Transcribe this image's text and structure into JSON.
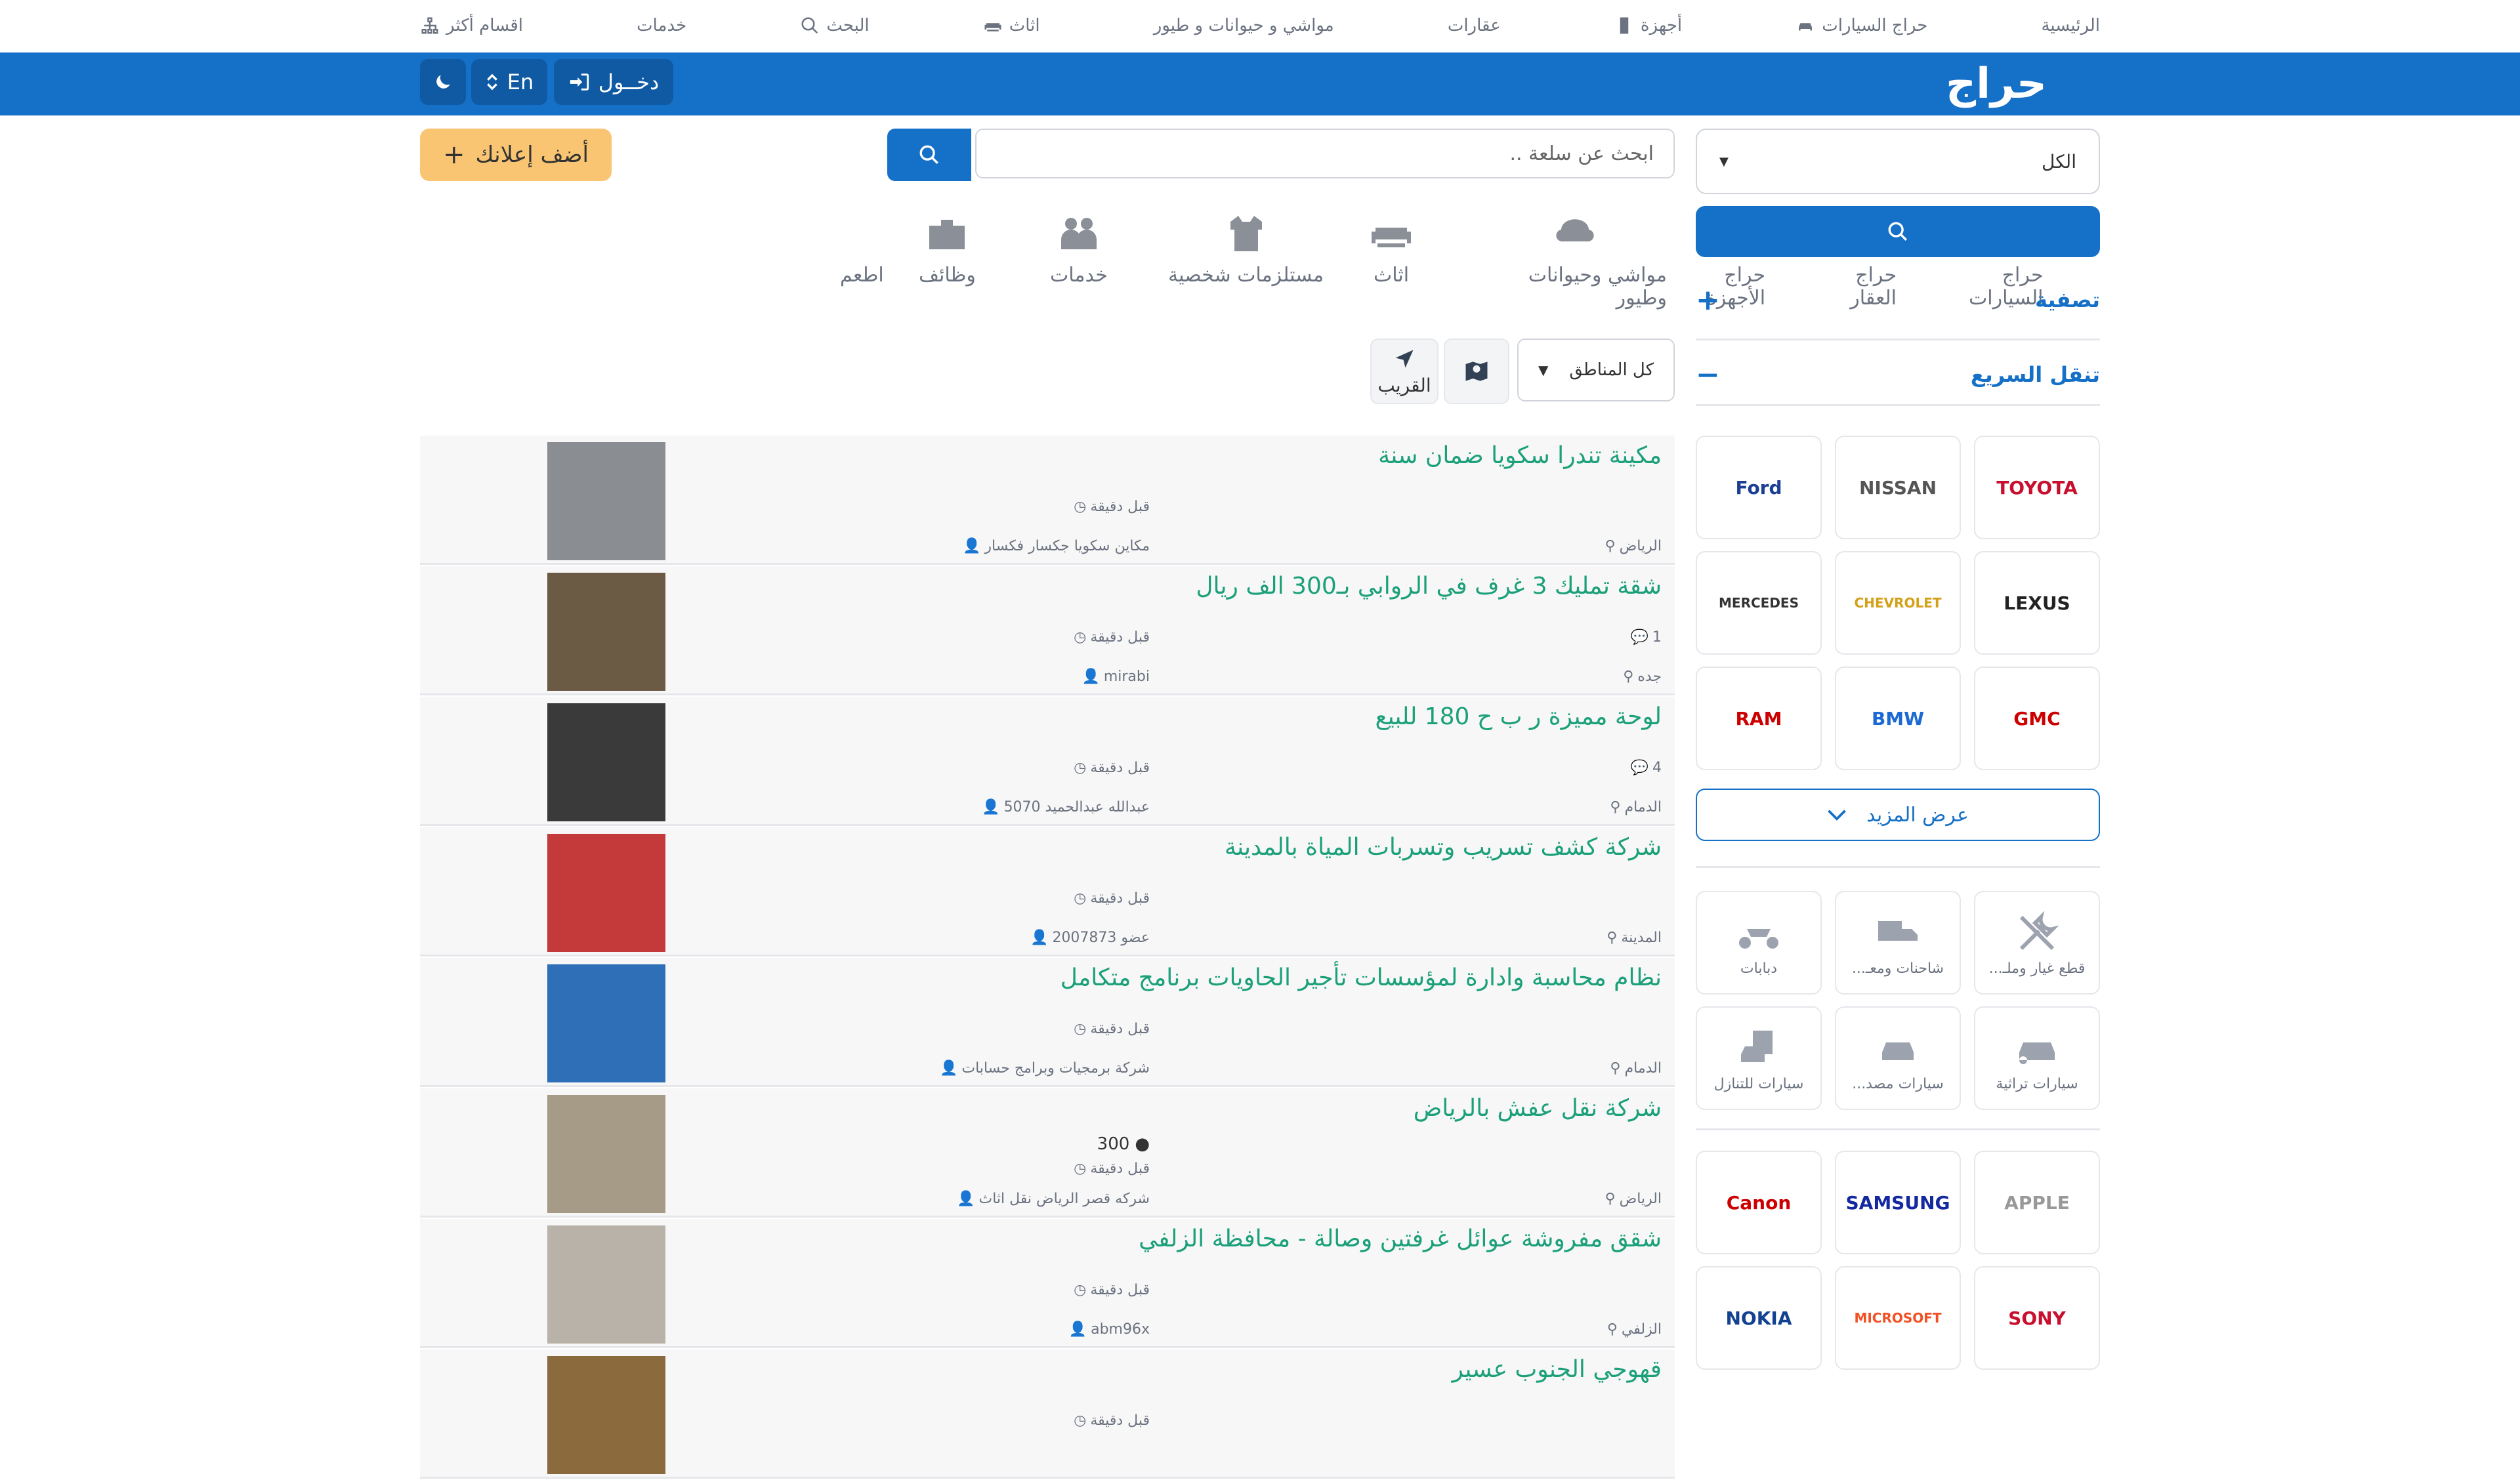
{
  "topnav": {
    "items": [
      {
        "label": "الرئيسية",
        "icon": "home"
      },
      {
        "label": "حراج السيارات",
        "icon": "car-icon"
      },
      {
        "label": "أجهزة",
        "icon": "mobile-icon"
      },
      {
        "label": "عقارات",
        "icon": "none"
      },
      {
        "label": "مواشي و حيوانات و طيور",
        "icon": "none"
      },
      {
        "label": "اثاث",
        "icon": "sofa-icon"
      },
      {
        "label": "البحث",
        "icon": "search-icon"
      },
      {
        "label": "خدمات",
        "icon": "none"
      },
      {
        "label": "اقسام أكثر",
        "icon": "sitemap-icon"
      }
    ]
  },
  "header": {
    "logo_text": "حراج",
    "login_label": "دخــول",
    "lang_label": "En",
    "brand_color": "#1570c7"
  },
  "search": {
    "placeholder": "ابحث عن سلعة ..",
    "add_ad_label": "أضف إعلانك"
  },
  "categories": [
    {
      "label": "حراج السيارات",
      "icon": "car-icon"
    },
    {
      "label": "حراج العقار",
      "icon": "house-icon"
    },
    {
      "label": "حراج الأجهزة",
      "icon": "devices-icon"
    },
    {
      "label": "مواشي وحيوانات وطيور",
      "icon": "sheep-icon"
    },
    {
      "label": "اثاث",
      "icon": "sofa-icon"
    },
    {
      "label": "مستلزمات شخصية",
      "icon": "clothes-icon"
    },
    {
      "label": "خدمات",
      "icon": "people-icon"
    },
    {
      "label": "وظائف",
      "icon": "briefcase-icon"
    },
    {
      "label": "اطعم",
      "icon": "none"
    }
  ],
  "filters": {
    "region_label": "كل المناطق",
    "nearby_label": "القريب"
  },
  "listings": [
    {
      "title": "مكينة تندرا سكويا ضمان سنة",
      "time": "قبل دقيقة",
      "comments": "",
      "price": "",
      "city": "الرياض",
      "user": "مكاين سكويا جكسار فكسار",
      "thumb_color": "#8a8d92"
    },
    {
      "title": "شقة تمليك 3 غرف في الروابي بـ300 الف ريال",
      "time": "قبل دقيقة",
      "comments": "1",
      "price": "",
      "city": "جده",
      "user": "mirabi",
      "thumb_color": "#6b5a44"
    },
    {
      "title": "لوحة مميزة ر ب ح 180 للبيع",
      "time": "قبل دقيقة",
      "comments": "4",
      "price": "",
      "city": "الدمام",
      "user": "عبدالله عبدالحميد 5070",
      "thumb_color": "#3a3a3a"
    },
    {
      "title": "شركة كشف تسريب وتسربات المياة بالمدينة",
      "time": "قبل دقيقة",
      "comments": "",
      "price": "",
      "city": "المدينة",
      "user": "عضو 2007873",
      "thumb_color": "#c43a3a"
    },
    {
      "title": "نظام محاسبة وادارة لمؤسسات تأجير الحاويات برنامج متكامل",
      "time": "قبل دقيقة",
      "comments": "",
      "price": "",
      "city": "الدمام",
      "user": "شركة برمجيات وبرامج حسابات",
      "thumb_color": "#2e6fb8"
    },
    {
      "title": "شركة نقل عفش بالرياض",
      "time": "قبل دقيقة",
      "comments": "",
      "price": "300",
      "city": "الرياض",
      "user": "شركه قصر الرياض نقل اثاث",
      "thumb_color": "#a69b86"
    },
    {
      "title": "شقق مفروشة عوائل غرفتين وصالة - محافظة الزلفي",
      "time": "قبل دقيقة",
      "comments": "",
      "price": "",
      "city": "الزلفي",
      "user": "abm96x",
      "thumb_color": "#b8b2a8"
    },
    {
      "title": "قهوجي الجنوب عسير",
      "time": "قبل دقيقة",
      "comments": "",
      "price": "",
      "city": "",
      "user": "",
      "thumb_color": "#8b6a3e"
    }
  ],
  "sidebar": {
    "select_all_label": "الكل",
    "filter_title": "تصفية",
    "quick_nav_title": "تنقل السريع",
    "show_more_label": "عرض المزيد",
    "car_brands": [
      {
        "label": "TOYOTA",
        "color": "#c8102e"
      },
      {
        "label": "NISSAN",
        "color": "#555555"
      },
      {
        "label": "Ford",
        "color": "#1c3f94"
      },
      {
        "label": "LEXUS",
        "color": "#222222"
      },
      {
        "label": "CHEVROLET",
        "color": "#d4a017"
      },
      {
        "label": "MERCEDES",
        "color": "#333333"
      },
      {
        "label": "GMC",
        "color": "#cc0000"
      },
      {
        "label": "BMW",
        "color": "#1c69d4"
      },
      {
        "label": "RAM",
        "color": "#cc0000"
      }
    ],
    "vehicle_types": [
      {
        "label": "قطع غيار وملـ...",
        "icon": "tools-icon"
      },
      {
        "label": "شاحنات ومعـ...",
        "icon": "truck-icon"
      },
      {
        "label": "دبابات",
        "icon": "atv-icon"
      },
      {
        "label": "سيارات تراثية",
        "icon": "classic-car-icon"
      },
      {
        "label": "سيارات مصد...",
        "icon": "crashed-car-icon"
      },
      {
        "label": "سيارات للتنازل",
        "icon": "transfer-car-icon"
      }
    ],
    "device_brands": [
      {
        "label": "APPLE",
        "color": "#999999"
      },
      {
        "label": "SAMSUNG",
        "color": "#1428a0"
      },
      {
        "label": "Canon",
        "color": "#cc0000"
      },
      {
        "label": "SONY",
        "color": "#c8102e"
      },
      {
        "label": "MICROSOFT",
        "color": "#f25022"
      },
      {
        "label": "NOKIA",
        "color": "#124191"
      }
    ]
  }
}
